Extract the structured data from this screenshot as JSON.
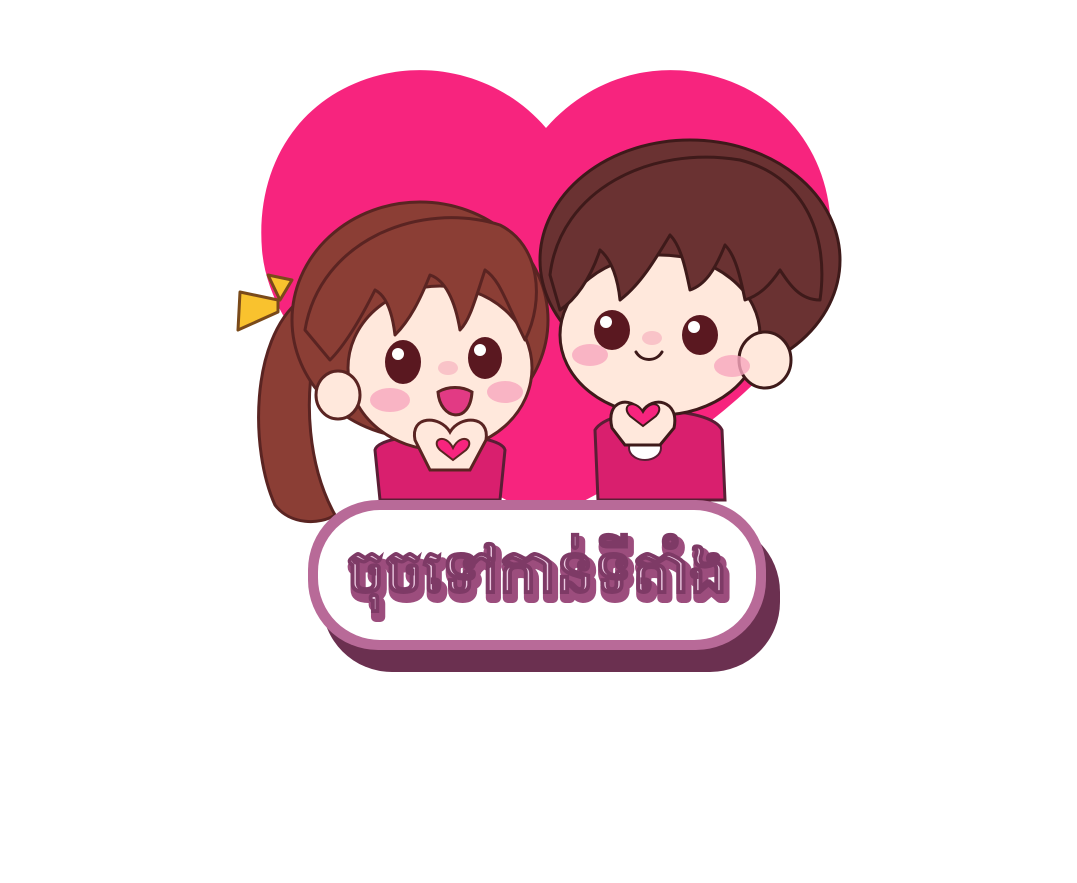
{
  "sticker": {
    "button_label": "ចុចទៅកាន់ទីតាំង",
    "heart_icon": "heart-icon",
    "colors": {
      "heart": "#F7247E",
      "button_fill": "#FFFFFF",
      "button_border": "#B86A98",
      "button_shadow": "#6B3050",
      "label_fill": "#EAC8E0",
      "label_stroke": "#9C4D7D",
      "girl_hair": "#8B3E35",
      "boy_hair": "#6A3232",
      "skin": "#FFE8DC",
      "blush": "#F7A6BE",
      "shirt": "#D91F6E",
      "bow": "#F9C22E"
    }
  }
}
